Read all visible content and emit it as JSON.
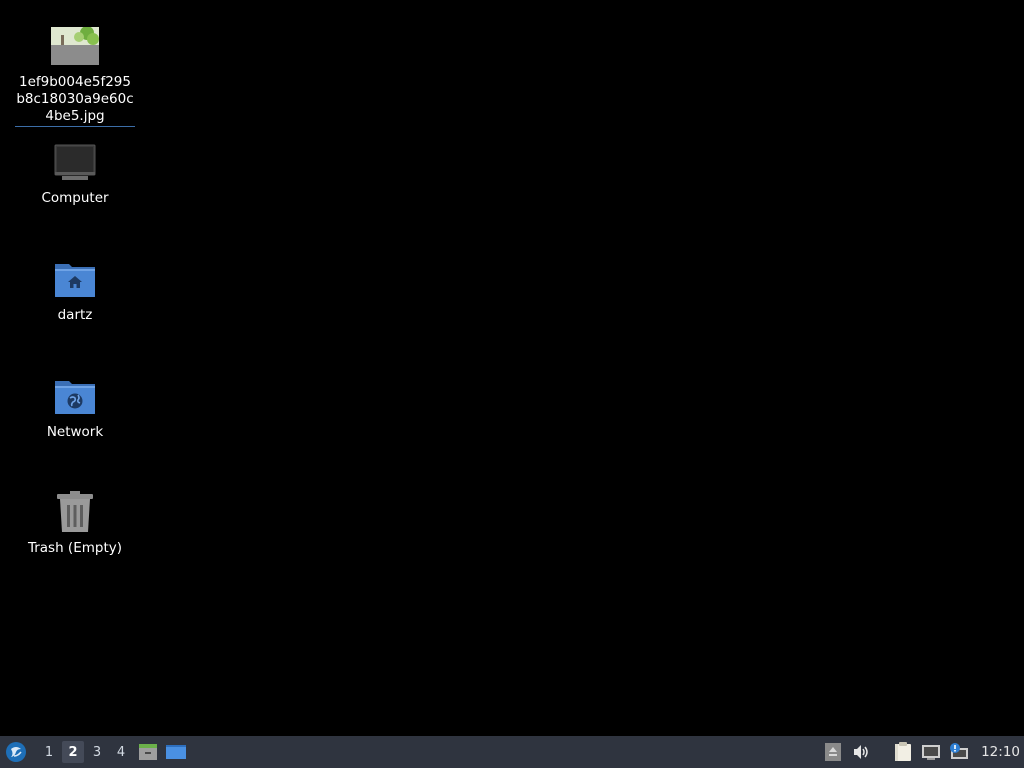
{
  "desktop": {
    "icons": [
      {
        "label": "1ef9b004e5f295b8c18030a9e60c4be5.jpg",
        "icon": "image-thumbnail-icon"
      },
      {
        "label": "Computer",
        "icon": "computer-icon"
      },
      {
        "label": "dartz",
        "icon": "home-folder-icon"
      },
      {
        "label": "Network",
        "icon": "network-folder-icon"
      },
      {
        "label": "Trash (Empty)",
        "icon": "trash-icon"
      }
    ]
  },
  "taskbar": {
    "start_icon": "lxqt-menu-icon",
    "workspaces": [
      "1",
      "2",
      "3",
      "4"
    ],
    "active_workspace": "2",
    "launchers": [
      "file-manager-icon",
      "show-desktop-icon"
    ],
    "tray": [
      "eject-icon",
      "volume-icon",
      "clipboard-icon",
      "network-monitor-icon",
      "update-notifier-icon"
    ],
    "clock": "12:10"
  }
}
